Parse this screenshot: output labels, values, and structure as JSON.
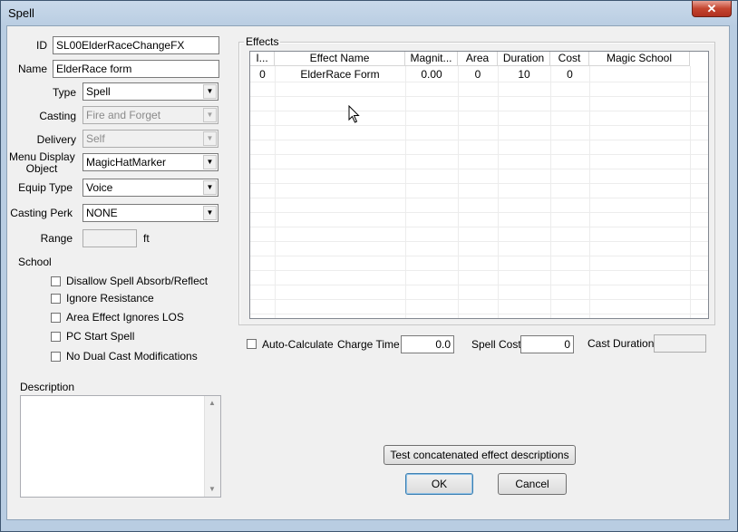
{
  "window": {
    "title": "Spell",
    "close_glyph": "✕"
  },
  "form": {
    "id_label": "ID",
    "id_value": "SL00ElderRaceChangeFX",
    "name_label": "Name",
    "name_value": "ElderRace form",
    "type_label": "Type",
    "type_value": "Spell",
    "casting_label": "Casting",
    "casting_value": "Fire and Forget",
    "delivery_label": "Delivery",
    "delivery_value": "Self",
    "menu_display_label_1": "Menu Display",
    "menu_display_label_2": "Object",
    "menu_display_value": "MagicHatMarker",
    "equip_type_label": "Equip Type",
    "equip_type_value": "Voice",
    "casting_perk_label": "Casting Perk",
    "casting_perk_value": "NONE",
    "range_label": "Range",
    "range_value": "",
    "range_unit": "ft",
    "school_label": "School",
    "description_label": "Description"
  },
  "checkboxes": [
    {
      "label": "Disallow Spell Absorb/Reflect",
      "checked": false
    },
    {
      "label": "Ignore Resistance",
      "checked": false
    },
    {
      "label": "Area Effect Ignores LOS",
      "checked": false
    },
    {
      "label": "PC Start Spell",
      "checked": false
    },
    {
      "label": "No Dual Cast Modifications",
      "checked": false
    }
  ],
  "effects": {
    "group_label": "Effects",
    "columns": [
      "I...",
      "Effect Name",
      "Magnit...",
      "Area",
      "Duration",
      "Cost",
      "Magic School"
    ],
    "rows": [
      [
        "0",
        "ElderRace Form",
        "0.00",
        "0",
        "10",
        "0",
        ""
      ]
    ]
  },
  "cost_row": {
    "auto_calc_label": "Auto-Calculate",
    "auto_calc_checked": false,
    "charge_time_label": "Charge Time",
    "charge_time_value": "0.0",
    "spell_cost_label": "Spell Cost",
    "spell_cost_value": "0",
    "cast_duration_label": "Cast Duration",
    "cast_duration_value": ""
  },
  "buttons": {
    "test_desc": "Test concatenated effect descriptions",
    "ok": "OK",
    "cancel": "Cancel"
  },
  "icons": {
    "dropdown": "▼",
    "scroll_up": "▲",
    "scroll_down": "▼",
    "cursor": "mouse-pointer-icon"
  }
}
